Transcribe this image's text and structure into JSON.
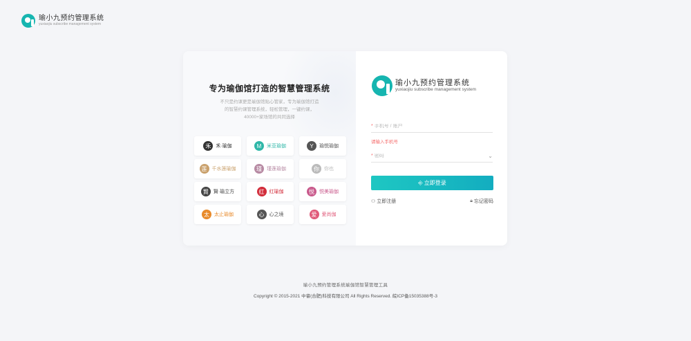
{
  "header": {
    "app_name": "瑜小九预约管理系统",
    "app_name_en": "yuxiaojiu subscribe management system"
  },
  "intro": {
    "title": "专为瑜伽馆打造的智慧管理系统",
    "desc_line1": "不只是约课更是瑜伽馆贴心管家，专为瑜伽馆打造",
    "desc_line2": "的智慧约课管理系统，轻松管理，一键约课，",
    "desc_line3": "40000+家场馆的共同选择"
  },
  "brands": [
    {
      "name": "禾·瑜伽",
      "icon": "禾",
      "color": "#333333"
    },
    {
      "name": "米亚瑜伽",
      "icon": "M",
      "color": "#2fb7a8"
    },
    {
      "name": "瑜悦瑜伽",
      "icon": "Y",
      "color": "#555555"
    },
    {
      "name": "千水莲瑜伽",
      "icon": "莲",
      "color": "#c9a06b"
    },
    {
      "name": "瑾莲瑜伽",
      "icon": "瑾",
      "color": "#b78aa3"
    },
    {
      "name": "你也",
      "icon": "你",
      "color": "#bbbbbb"
    },
    {
      "name": "賢·瑜立方",
      "icon": "賢",
      "color": "#444444"
    },
    {
      "name": "红瑜伽",
      "icon": "红",
      "color": "#d22c3a"
    },
    {
      "name": "悦美瑜伽",
      "icon": "悦",
      "color": "#c95a8c"
    },
    {
      "name": "太止瑜伽",
      "icon": "太",
      "color": "#e88a2a"
    },
    {
      "name": "心之境",
      "icon": "心",
      "color": "#555555"
    },
    {
      "name": "爱尚伽",
      "icon": "爱",
      "color": "#e05a7a"
    }
  ],
  "login": {
    "logo_cn": "瑜小九预约管理系统",
    "logo_en": "yuxiaojiu subscribe management system",
    "account_placeholder": "手机号 / 账户",
    "account_error": "请输入手机号",
    "password_placeholder": "密码",
    "submit_label": "立即登录",
    "register_label": "立即注册",
    "forgot_label": "忘记密码"
  },
  "footer": {
    "line1": "瑜小九预约管理系统瑜伽馆智慧管理工具",
    "line2": "Copyright © 2015-2021 中睿(合肥)科技有限公司 All Rights Reserved. 皖ICP备15035388号-3"
  },
  "colors": {
    "brand": "#16b5b0",
    "button": "#1ec7c2",
    "error": "#f56c6c"
  }
}
